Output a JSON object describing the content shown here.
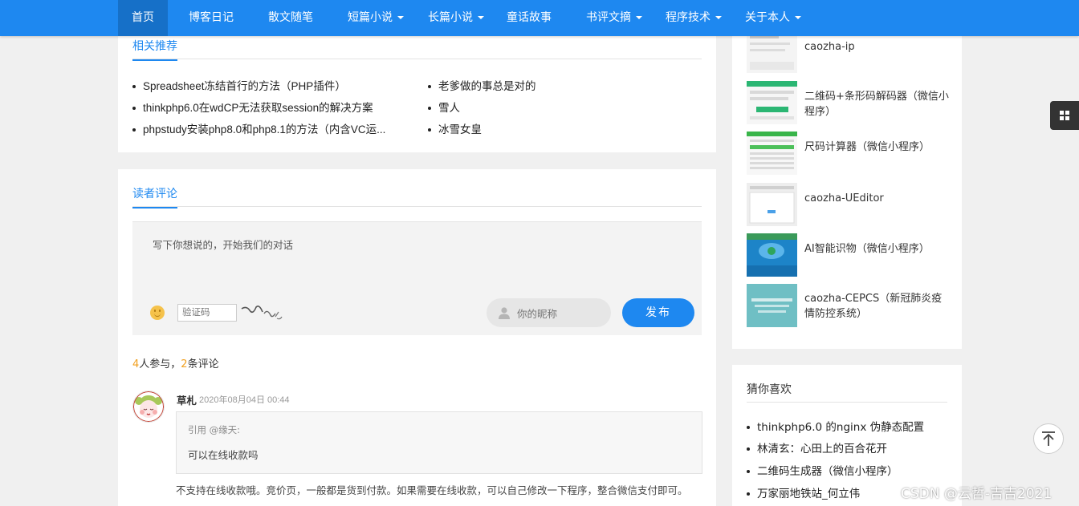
{
  "nav": {
    "items": [
      {
        "label": "首页",
        "dropdown": false,
        "active": true
      },
      {
        "label": "博客日记",
        "dropdown": false
      },
      {
        "label": "散文随笔",
        "dropdown": false
      },
      {
        "label": "短篇小说",
        "dropdown": true
      },
      {
        "label": "长篇小说",
        "dropdown": true
      },
      {
        "label": "童话故事",
        "dropdown": false
      },
      {
        "label": "书评文摘",
        "dropdown": true
      },
      {
        "label": "程序技术",
        "dropdown": true
      },
      {
        "label": "关于本人",
        "dropdown": true
      }
    ]
  },
  "related": {
    "title": "相关推荐",
    "left": [
      "Spreadsheet冻结首行的方法（PHP插件）",
      "thinkphp6.0在wdCP无法获取session的解决方案",
      "phpstudy安装php8.0和php8.1的方法（内含VC运..."
    ],
    "right": [
      "老爹做的事总是对的",
      "雪人",
      "冰雪女皇"
    ]
  },
  "comments": {
    "title": "读者评论",
    "placeholder": "写下你想说的，开始我们的对话",
    "captcha_placeholder": "验证码",
    "nickname_placeholder": "你的昵称",
    "submit_label": "发布",
    "stats": {
      "participants": "4",
      "participants_text": "人参与，",
      "count": "2",
      "count_text": "条评论"
    },
    "items": [
      {
        "author": "草札",
        "date": "2020年08月04日 00:44",
        "quote_head": "引用 @缘天:",
        "quote_body": "可以在线收款吗",
        "reply": "不支持在线收款哦。竞价页，一般都是货到付款。如果需要在线收款，可以自己修改一下程序，整合微信支付即可。"
      }
    ]
  },
  "sidebar": {
    "items": [
      {
        "text": "caozha-ip"
      },
      {
        "text": "二维码+条形码解码器（微信小程序）"
      },
      {
        "text": "尺码计算器（微信小程序）"
      },
      {
        "text": "caozha-UEditor"
      },
      {
        "text": "AI智能识物（微信小程序）"
      },
      {
        "text": "caozha-CEPCS（新冠肺炎疫情防控系统）"
      }
    ],
    "guess": {
      "title": "猜你喜欢",
      "items": [
        "thinkphp6.0 的nginx 伪静态配置",
        "林清玄：心田上的百合花开",
        "二维码生成器（微信小程序）",
        "万家丽地铁站_何立伟"
      ]
    }
  },
  "watermark": "CSDN @云哲-吉吉2021",
  "colors": {
    "nav": "#1e88f0",
    "nav_active": "#1670c8",
    "accent_number": "#f0a020"
  }
}
